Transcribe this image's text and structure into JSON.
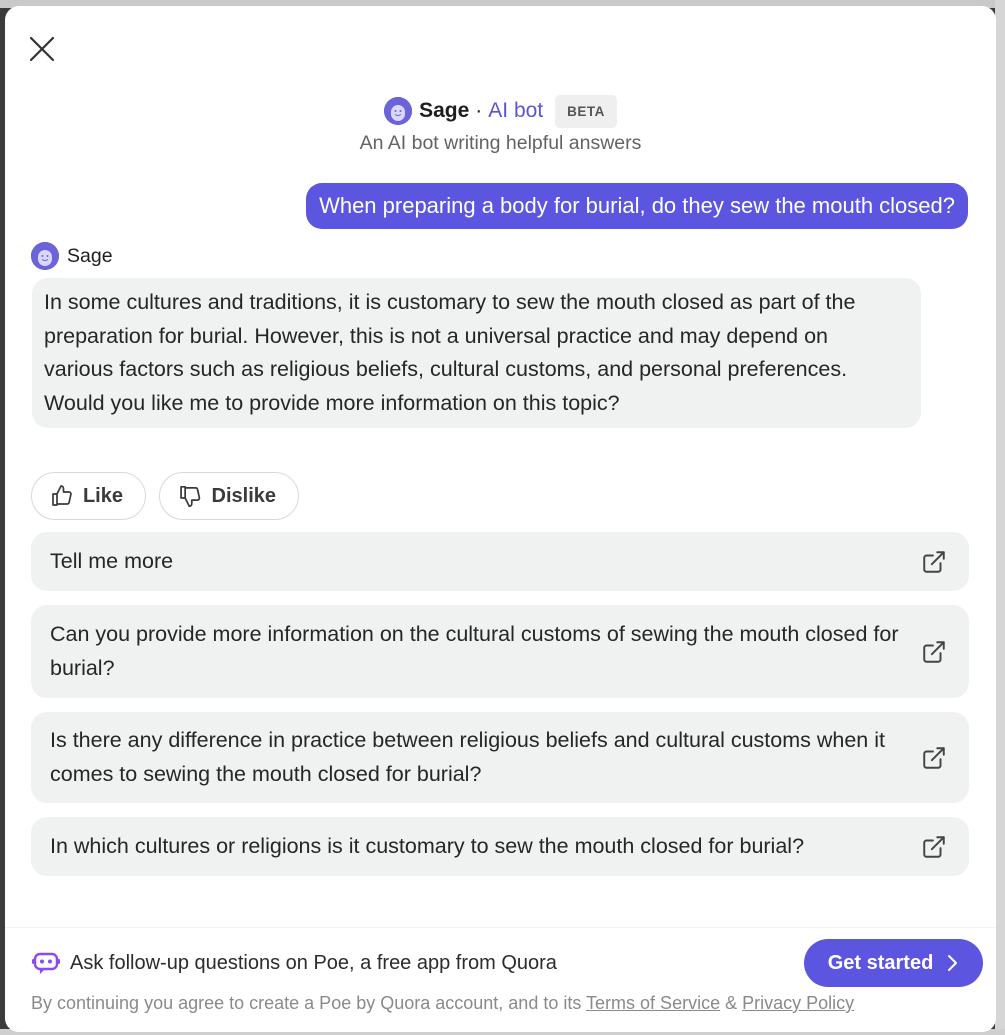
{
  "header": {
    "bot_name": "Sage",
    "separator": "·",
    "bot_type": "AI bot",
    "badge": "BETA",
    "subtitle": "An AI bot writing helpful answers"
  },
  "conversation": {
    "user_question": "When preparing a body for burial, do they sew the mouth closed?",
    "bot_label": "Sage",
    "bot_answer": "In some cultures and traditions, it is customary to sew the mouth closed as part of the preparation for burial. However, this is not a universal practice and may depend on various factors such as religious beliefs, cultural customs, and personal preferences. Would you like me to provide more information on this topic?"
  },
  "reactions": {
    "like_label": "Like",
    "dislike_label": "Dislike"
  },
  "suggestions": [
    {
      "text": "Tell me more"
    },
    {
      "text": "Can you provide more information on the cultural customs of sewing the mouth closed for burial?"
    },
    {
      "text": "Is there any difference in practice between religious beliefs and cultural customs when it comes to sewing the mouth closed for burial?"
    },
    {
      "text": "In which cultures or religions is it customary to sew the mouth closed for burial?"
    }
  ],
  "footer": {
    "promo_text": "Ask follow-up questions on Poe, a free app from Quora",
    "cta_label": "Get started",
    "legal_prefix": "By continuing you agree to create a Poe by Quora account, and to its",
    "terms_label": "Terms of Service",
    "ampersand": "&",
    "privacy_label": "Privacy Policy"
  },
  "colors": {
    "accent": "#5b55e0",
    "bubble_bg": "#f0f1f1",
    "avatar": "#6b63d8"
  },
  "icons": [
    "close-icon",
    "sage-avatar-icon",
    "thumbs-up-icon",
    "thumbs-down-icon",
    "external-link-icon",
    "poe-logo-icon",
    "chevron-right-icon"
  ]
}
